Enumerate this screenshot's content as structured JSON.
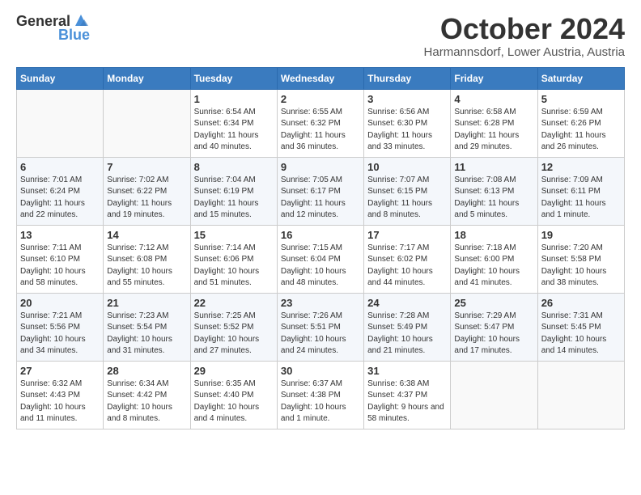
{
  "logo": {
    "general": "General",
    "blue": "Blue"
  },
  "header": {
    "month": "October 2024",
    "location": "Harmannsdorf, Lower Austria, Austria"
  },
  "weekdays": [
    "Sunday",
    "Monday",
    "Tuesday",
    "Wednesday",
    "Thursday",
    "Friday",
    "Saturday"
  ],
  "weeks": [
    [
      {
        "day": "",
        "info": ""
      },
      {
        "day": "",
        "info": ""
      },
      {
        "day": "1",
        "info": "Sunrise: 6:54 AM\nSunset: 6:34 PM\nDaylight: 11 hours and 40 minutes."
      },
      {
        "day": "2",
        "info": "Sunrise: 6:55 AM\nSunset: 6:32 PM\nDaylight: 11 hours and 36 minutes."
      },
      {
        "day": "3",
        "info": "Sunrise: 6:56 AM\nSunset: 6:30 PM\nDaylight: 11 hours and 33 minutes."
      },
      {
        "day": "4",
        "info": "Sunrise: 6:58 AM\nSunset: 6:28 PM\nDaylight: 11 hours and 29 minutes."
      },
      {
        "day": "5",
        "info": "Sunrise: 6:59 AM\nSunset: 6:26 PM\nDaylight: 11 hours and 26 minutes."
      }
    ],
    [
      {
        "day": "6",
        "info": "Sunrise: 7:01 AM\nSunset: 6:24 PM\nDaylight: 11 hours and 22 minutes."
      },
      {
        "day": "7",
        "info": "Sunrise: 7:02 AM\nSunset: 6:22 PM\nDaylight: 11 hours and 19 minutes."
      },
      {
        "day": "8",
        "info": "Sunrise: 7:04 AM\nSunset: 6:19 PM\nDaylight: 11 hours and 15 minutes."
      },
      {
        "day": "9",
        "info": "Sunrise: 7:05 AM\nSunset: 6:17 PM\nDaylight: 11 hours and 12 minutes."
      },
      {
        "day": "10",
        "info": "Sunrise: 7:07 AM\nSunset: 6:15 PM\nDaylight: 11 hours and 8 minutes."
      },
      {
        "day": "11",
        "info": "Sunrise: 7:08 AM\nSunset: 6:13 PM\nDaylight: 11 hours and 5 minutes."
      },
      {
        "day": "12",
        "info": "Sunrise: 7:09 AM\nSunset: 6:11 PM\nDaylight: 11 hours and 1 minute."
      }
    ],
    [
      {
        "day": "13",
        "info": "Sunrise: 7:11 AM\nSunset: 6:10 PM\nDaylight: 10 hours and 58 minutes."
      },
      {
        "day": "14",
        "info": "Sunrise: 7:12 AM\nSunset: 6:08 PM\nDaylight: 10 hours and 55 minutes."
      },
      {
        "day": "15",
        "info": "Sunrise: 7:14 AM\nSunset: 6:06 PM\nDaylight: 10 hours and 51 minutes."
      },
      {
        "day": "16",
        "info": "Sunrise: 7:15 AM\nSunset: 6:04 PM\nDaylight: 10 hours and 48 minutes."
      },
      {
        "day": "17",
        "info": "Sunrise: 7:17 AM\nSunset: 6:02 PM\nDaylight: 10 hours and 44 minutes."
      },
      {
        "day": "18",
        "info": "Sunrise: 7:18 AM\nSunset: 6:00 PM\nDaylight: 10 hours and 41 minutes."
      },
      {
        "day": "19",
        "info": "Sunrise: 7:20 AM\nSunset: 5:58 PM\nDaylight: 10 hours and 38 minutes."
      }
    ],
    [
      {
        "day": "20",
        "info": "Sunrise: 7:21 AM\nSunset: 5:56 PM\nDaylight: 10 hours and 34 minutes."
      },
      {
        "day": "21",
        "info": "Sunrise: 7:23 AM\nSunset: 5:54 PM\nDaylight: 10 hours and 31 minutes."
      },
      {
        "day": "22",
        "info": "Sunrise: 7:25 AM\nSunset: 5:52 PM\nDaylight: 10 hours and 27 minutes."
      },
      {
        "day": "23",
        "info": "Sunrise: 7:26 AM\nSunset: 5:51 PM\nDaylight: 10 hours and 24 minutes."
      },
      {
        "day": "24",
        "info": "Sunrise: 7:28 AM\nSunset: 5:49 PM\nDaylight: 10 hours and 21 minutes."
      },
      {
        "day": "25",
        "info": "Sunrise: 7:29 AM\nSunset: 5:47 PM\nDaylight: 10 hours and 17 minutes."
      },
      {
        "day": "26",
        "info": "Sunrise: 7:31 AM\nSunset: 5:45 PM\nDaylight: 10 hours and 14 minutes."
      }
    ],
    [
      {
        "day": "27",
        "info": "Sunrise: 6:32 AM\nSunset: 4:43 PM\nDaylight: 10 hours and 11 minutes."
      },
      {
        "day": "28",
        "info": "Sunrise: 6:34 AM\nSunset: 4:42 PM\nDaylight: 10 hours and 8 minutes."
      },
      {
        "day": "29",
        "info": "Sunrise: 6:35 AM\nSunset: 4:40 PM\nDaylight: 10 hours and 4 minutes."
      },
      {
        "day": "30",
        "info": "Sunrise: 6:37 AM\nSunset: 4:38 PM\nDaylight: 10 hours and 1 minute."
      },
      {
        "day": "31",
        "info": "Sunrise: 6:38 AM\nSunset: 4:37 PM\nDaylight: 9 hours and 58 minutes."
      },
      {
        "day": "",
        "info": ""
      },
      {
        "day": "",
        "info": ""
      }
    ]
  ]
}
